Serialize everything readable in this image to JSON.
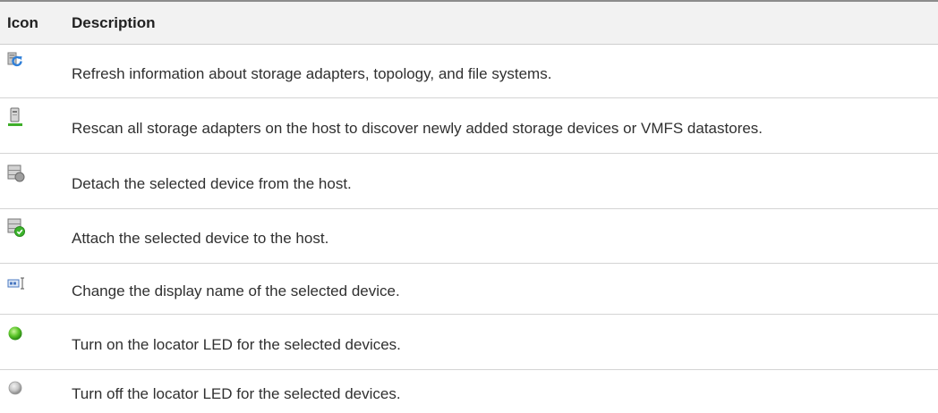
{
  "table": {
    "headers": {
      "icon": "Icon",
      "description": "Description"
    },
    "rows": [
      {
        "icon": "refresh-icon",
        "description": "Refresh information about storage adapters, topology, and file systems."
      },
      {
        "icon": "rescan-storage-icon",
        "description": "Rescan all storage adapters on the host to discover newly added storage devices or VMFS datastores."
      },
      {
        "icon": "detach-device-icon",
        "description": "Detach the selected device from the host."
      },
      {
        "icon": "attach-device-icon",
        "description": "Attach the selected device to the host."
      },
      {
        "icon": "rename-device-icon",
        "description": "Change the display name of the selected device."
      },
      {
        "icon": "led-on-icon",
        "description": "Turn on the locator LED for the selected devices."
      },
      {
        "icon": "led-off-icon",
        "description": "Turn off the locator LED for the selected devices."
      }
    ]
  },
  "colors": {
    "header_bg": "#f2f2f2",
    "rule": "#d4d4d4",
    "led_on": "#5cc52a",
    "led_off": "#c8c8c8",
    "refresh_blue": "#2f7fd8"
  }
}
